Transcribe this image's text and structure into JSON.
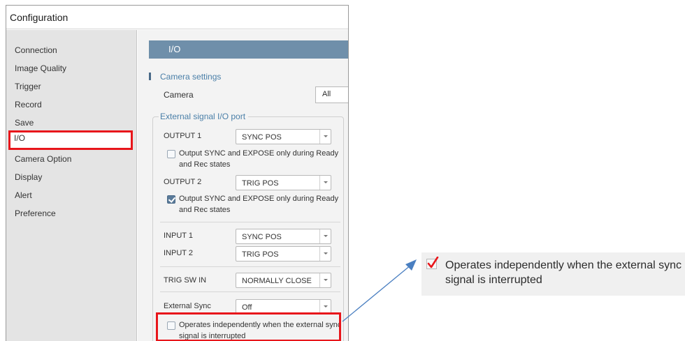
{
  "window": {
    "title": "Configuration"
  },
  "sidebar": {
    "items": [
      {
        "label": "Connection"
      },
      {
        "label": "Image Quality"
      },
      {
        "label": "Trigger"
      },
      {
        "label": "Record"
      },
      {
        "label": "Save"
      },
      {
        "label": "I/O",
        "selected": true
      },
      {
        "label": "Camera Option"
      },
      {
        "label": "Display"
      },
      {
        "label": "Alert"
      },
      {
        "label": "Preference"
      }
    ]
  },
  "main": {
    "section_title": "I/O",
    "camera_settings": {
      "heading": "Camera settings",
      "camera_label": "Camera",
      "camera_value": "All"
    },
    "io_port": {
      "group_title": "External signal I/O port",
      "output1": {
        "label": "OUTPUT 1",
        "value": "SYNC POS",
        "checkbox_label": "Output SYNC and EXPOSE only during Ready and Rec states",
        "checked": false
      },
      "output2": {
        "label": "OUTPUT 2",
        "value": "TRIG POS",
        "checkbox_label": "Output SYNC and EXPOSE only during Ready and Rec states",
        "checked": true
      },
      "input1": {
        "label": "INPUT 1",
        "value": "SYNC POS"
      },
      "input2": {
        "label": "INPUT 2",
        "value": "TRIG POS"
      },
      "trig_sw_in": {
        "label": "TRIG SW IN",
        "value": "NORMALLY CLOSE"
      },
      "external_sync": {
        "label": "External Sync",
        "value": "Off"
      },
      "independent": {
        "label": "Operates independently when the external sync signal is interrupted",
        "checked": false
      }
    }
  },
  "callout": {
    "text": "Operates independently when the external sync signal is interrupted",
    "mark_icon": "red-checkmark-icon",
    "accent_color": "#e8161b",
    "arrow_color": "#4a7fc1"
  }
}
